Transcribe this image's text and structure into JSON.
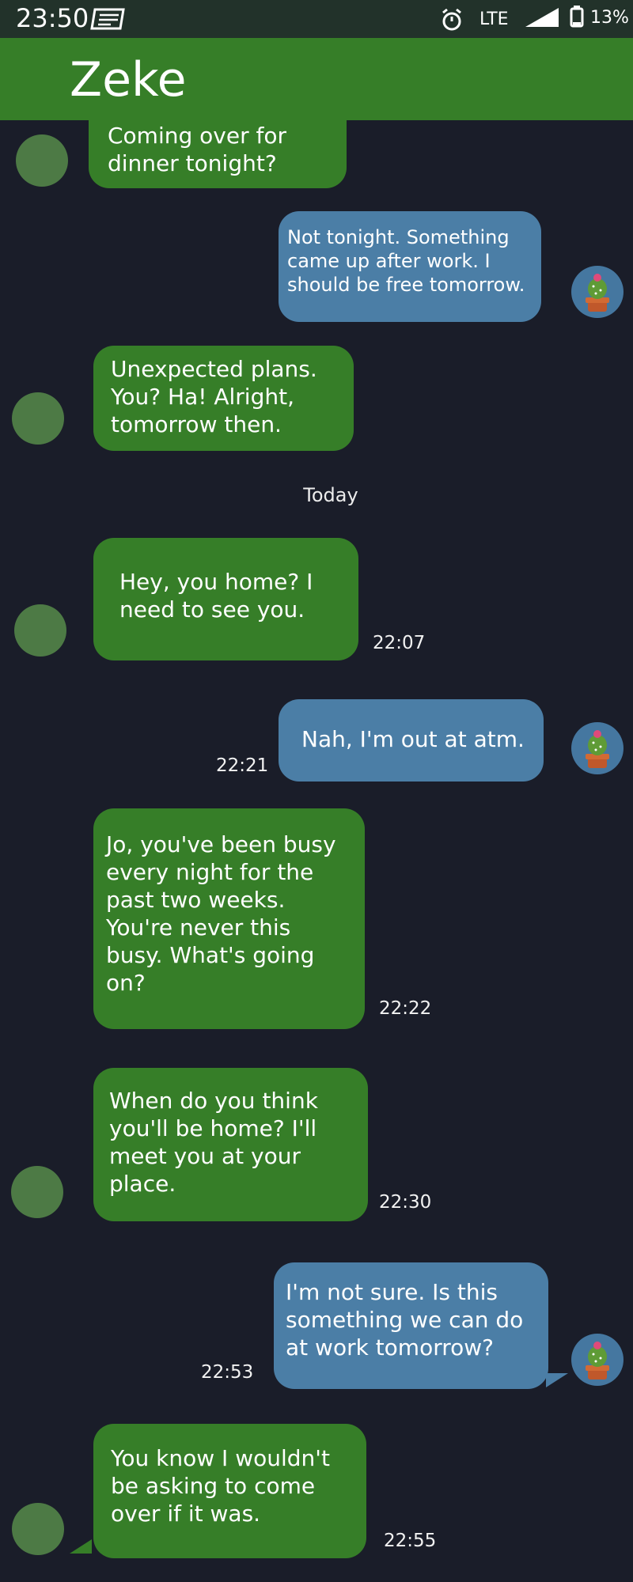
{
  "status_bar": {
    "time": "23:50",
    "network": "LTE",
    "battery": "13%"
  },
  "header": {
    "title": "Zeke"
  },
  "colors": {
    "incoming_bubble": "#367e28",
    "outgoing_bubble": "#4b7ea6",
    "background": "#1a1d29",
    "header": "#367e28"
  },
  "day_divider": "Today",
  "messages": [
    {
      "direction": "in",
      "text": "Coming over for\ndinner tonight?",
      "time": ""
    },
    {
      "direction": "out",
      "text": "Not tonight. Something\ncame up after work. I\nshould be free tomorrow.",
      "time": ""
    },
    {
      "direction": "in",
      "text": "Unexpected plans.\nYou? Ha! Alright,\ntomorrow then.",
      "time": ""
    },
    {
      "direction": "in",
      "text": "Hey, you home? I\nneed to see you.",
      "time": "22:07"
    },
    {
      "direction": "out",
      "text": "Nah, I'm out at atm.",
      "time": "22:21"
    },
    {
      "direction": "in",
      "text": "Jo, you've been busy\nevery night for the\npast two weeks.\nYou're never this\nbusy. What's going\non?",
      "time": "22:22"
    },
    {
      "direction": "in",
      "text": "When do you think\nyou'll be home? I'll\nmeet you at your\nplace.",
      "time": "22:30"
    },
    {
      "direction": "out",
      "text": "I'm not sure. Is this\nsomething we can do\nat work tomorrow?",
      "time": "22:53"
    },
    {
      "direction": "in",
      "text": "You know I wouldn't\nbe asking to come\nover if it was.",
      "time": "22:55"
    }
  ]
}
